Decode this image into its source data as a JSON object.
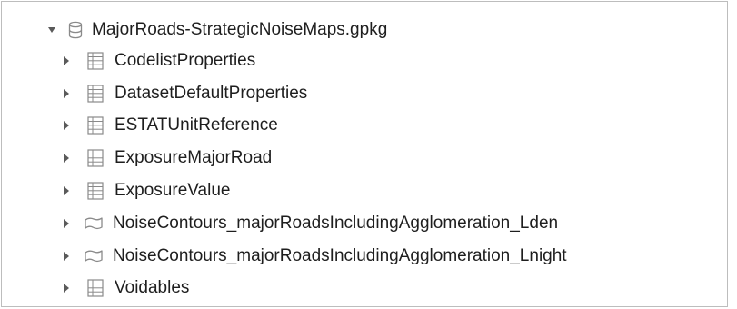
{
  "tree": {
    "root": {
      "label": "MajorRoads-StrategicNoiseMaps.gpkg",
      "icon": "database-icon",
      "expanded": true
    },
    "children": [
      {
        "label": "CodelistProperties",
        "icon": "table-icon",
        "expanded": false
      },
      {
        "label": "DatasetDefaultProperties",
        "icon": "table-icon",
        "expanded": false
      },
      {
        "label": "ESTATUnitReference",
        "icon": "table-icon",
        "expanded": false
      },
      {
        "label": "ExposureMajorRoad",
        "icon": "table-icon",
        "expanded": false
      },
      {
        "label": "ExposureValue",
        "icon": "table-icon",
        "expanded": false
      },
      {
        "label": "NoiseContours_majorRoadsIncludingAgglomeration_Lden",
        "icon": "polygon-layer-icon",
        "expanded": false
      },
      {
        "label": "NoiseContours_majorRoadsIncludingAgglomeration_Lnight",
        "icon": "polygon-layer-icon",
        "expanded": false
      },
      {
        "label": "Voidables",
        "icon": "table-icon",
        "expanded": false
      }
    ]
  },
  "colors": {
    "text": "#1e1e1e",
    "arrow": "#5a5a5a",
    "icon_stroke": "#8a8a8a",
    "border": "#bdbdbd"
  }
}
